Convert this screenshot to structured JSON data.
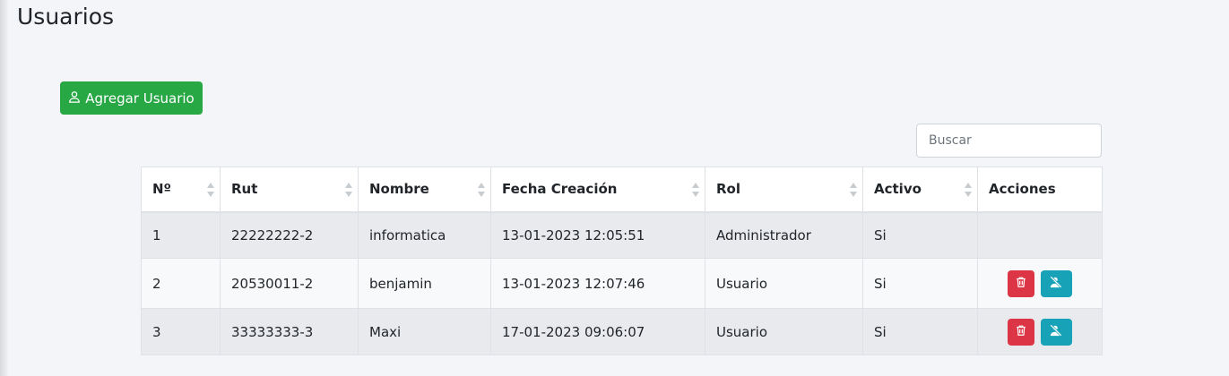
{
  "page": {
    "title": "Usuarios"
  },
  "toolbar": {
    "add_user_label": "Agregar Usuario"
  },
  "search": {
    "placeholder": "Buscar",
    "value": ""
  },
  "table": {
    "columns": [
      "Nº",
      "Rut",
      "Nombre",
      "Fecha Creación",
      "Rol",
      "Activo",
      "Acciones"
    ],
    "sortable": [
      true,
      true,
      true,
      true,
      true,
      true,
      false
    ],
    "rows": [
      {
        "num": "1",
        "rut": "22222222-2",
        "nombre": "informatica",
        "fecha": "13-01-2023 12:05:51",
        "rol": "Administrador",
        "activo": "Si",
        "actions": []
      },
      {
        "num": "2",
        "rut": "20530011-2",
        "nombre": "benjamin",
        "fecha": "13-01-2023 12:07:46",
        "rol": "Usuario",
        "activo": "Si",
        "actions": [
          "trash-icon",
          "user-slash-icon"
        ]
      },
      {
        "num": "3",
        "rut": "33333333-3",
        "nombre": "Maxi",
        "fecha": "17-01-2023 09:06:07",
        "rol": "Usuario",
        "activo": "Si",
        "actions": [
          "trash-icon",
          "user-slash-icon"
        ]
      }
    ]
  },
  "colors": {
    "add_button": "#28a745",
    "delete_button": "#dc3545",
    "deactivate_button": "#17a2b8"
  }
}
